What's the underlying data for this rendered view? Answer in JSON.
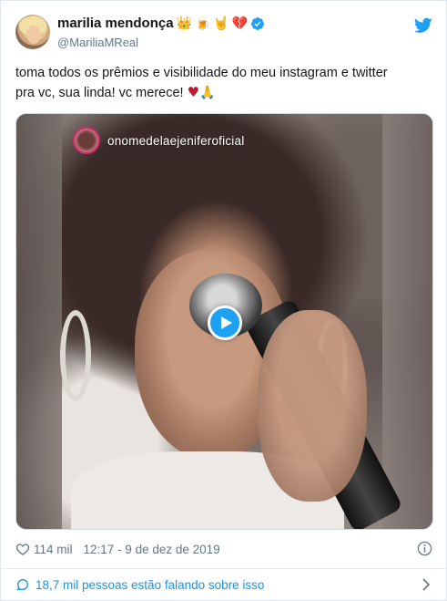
{
  "author": {
    "display_name": "marilia mendonça",
    "emojis": [
      "👑",
      "🍺",
      "🤘",
      "💔"
    ],
    "handle": "@MariliaMReal",
    "verified": true
  },
  "tweet": {
    "line1": "toma todos os prêmios e visibilidade do meu instagram e twitter",
    "line2": "pra vc, sua linda! vc merece!",
    "heart": "♥",
    "hands": "🙏"
  },
  "media": {
    "instagram_username": "onomedelaejeniferoficial",
    "play_label": "play"
  },
  "meta": {
    "likes": "114 mil",
    "timestamp": "12:17 - 9 de dez de 2019"
  },
  "conversation": {
    "label": "18,7 mil pessoas estão falando sobre isso"
  },
  "colors": {
    "accent": "#1da1f2",
    "link": "#1b95e0",
    "muted": "#657786",
    "heart": "#be1931"
  },
  "icons": [
    "twitter-bird-icon",
    "verified-badge-icon",
    "heart-icon",
    "info-icon",
    "comment-bubble-icon",
    "chevron-right-icon",
    "play-icon"
  ]
}
